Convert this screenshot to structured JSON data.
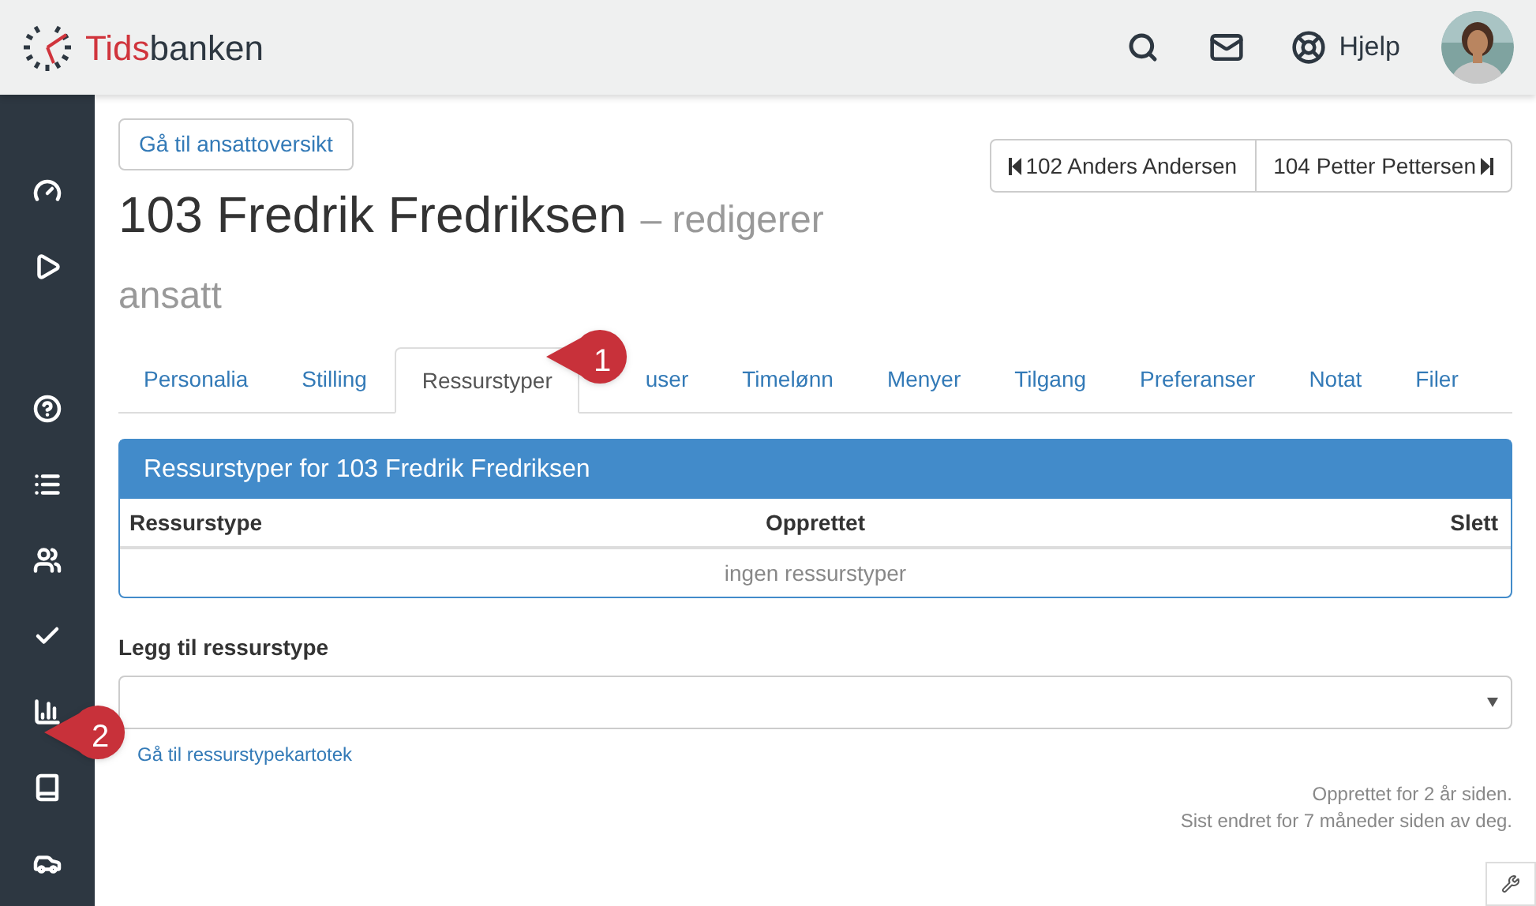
{
  "brand": {
    "part_1": "Tids",
    "part_2": "banken"
  },
  "header": {
    "help": "Hjelp"
  },
  "back_button": "Gå til ansattoversikt",
  "title": {
    "name": "103 Fredrik Fredriksen",
    "suffix": "– redigerer ansatt"
  },
  "pager": {
    "previous": "102 Anders Andersen",
    "next": "104 Petter Pettersen"
  },
  "tabs": [
    {
      "label": "Personalia",
      "selected": false
    },
    {
      "label": "Stilling",
      "selected": false
    },
    {
      "label": "Ressurstyper",
      "selected": true
    },
    {
      "label": "user",
      "selected": false
    },
    {
      "label": "Timelønn",
      "selected": false
    },
    {
      "label": "Menyer",
      "selected": false
    },
    {
      "label": "Tilgang",
      "selected": false
    },
    {
      "label": "Preferanser",
      "selected": false
    },
    {
      "label": "Notat",
      "selected": false
    },
    {
      "label": "Filer",
      "selected": false
    }
  ],
  "panel": {
    "title": "Ressurstyper for 103 Fredrik Fredriksen",
    "columns": [
      "Ressurstype",
      "Opprettet",
      "Slett"
    ],
    "empty": "ingen ressurstyper"
  },
  "add": {
    "label": "Legg til ressurstype",
    "link": "Gå til ressurstypekartotek"
  },
  "footer": [
    "Opprettet for 2 år siden.",
    "Sist endret for 7 måneder siden av deg."
  ],
  "callouts": [
    "1",
    "2"
  ]
}
